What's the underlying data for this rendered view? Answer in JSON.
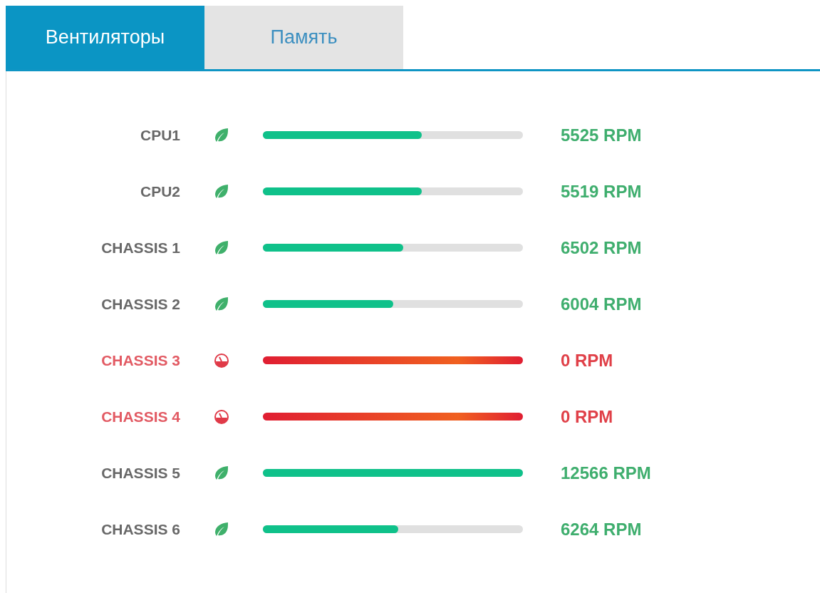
{
  "tabs": [
    {
      "label": "Вентиляторы",
      "selected": true
    },
    {
      "label": "Память",
      "selected": false
    }
  ],
  "fans": [
    {
      "name": "CPU1",
      "kind": "ok",
      "level": 0.61,
      "reading": "5525 RPM"
    },
    {
      "name": "CPU2",
      "kind": "ok",
      "level": 0.61,
      "reading": "5519 RPM"
    },
    {
      "name": "CHASSIS 1",
      "kind": "ok",
      "level": 0.54,
      "reading": "6502 RPM"
    },
    {
      "name": "CHASSIS 2",
      "kind": "ok",
      "level": 0.5,
      "reading": "6004 RPM"
    },
    {
      "name": "CHASSIS 3",
      "kind": "fail",
      "reading": "0 RPM"
    },
    {
      "name": "CHASSIS 4",
      "kind": "fail",
      "reading": "0 RPM"
    },
    {
      "name": "CHASSIS 5",
      "kind": "ok",
      "level": 1,
      "reading": "12566 RPM"
    },
    {
      "name": "CHASSIS 6",
      "kind": "ok",
      "level": 0.52,
      "reading": "6264 RPM"
    }
  ]
}
